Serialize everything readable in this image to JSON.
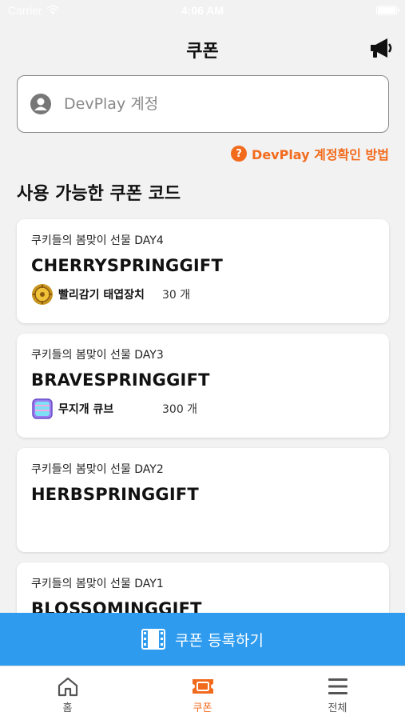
{
  "status_bar": {
    "carrier": "Carrier",
    "time": "4:06 AM"
  },
  "header": {
    "title": "쿠폰",
    "notice_icon": "megaphone-icon"
  },
  "account": {
    "placeholder": "DevPlay 계정",
    "value": ""
  },
  "help_link": {
    "label": "DevPlay 계정확인 방법",
    "icon": "question-icon"
  },
  "section_title": "사용 가능한 쿠폰 코드",
  "coupons": [
    {
      "event": "쿠키들의 봄맞이 선물 DAY4",
      "code": "CHERRYSPRINGGIFT",
      "reward_name": "빨리감기 태엽장치",
      "reward_qty": "30 개",
      "reward_icon": "clockwork-icon"
    },
    {
      "event": "쿠키들의 봄맞이 선물 DAY3",
      "code": "BRAVESPRINGGIFT",
      "reward_name": "무지개 큐브",
      "reward_qty": "300 개",
      "reward_icon": "rainbow-cube-icon"
    },
    {
      "event": "쿠키들의 봄맞이 선물 DAY2",
      "code": "HERBSPRINGGIFT",
      "reward_name": "",
      "reward_qty": ""
    },
    {
      "event": "쿠키들의 봄맞이 선물 DAY1",
      "code": "BLOSSOMINGGIFT",
      "reward_name": "",
      "reward_qty": ""
    }
  ],
  "register_button": {
    "label": "쿠폰 등록하기",
    "icon": "film-icon"
  },
  "tabs": [
    {
      "label": "홈",
      "icon": "home-icon"
    },
    {
      "label": "쿠폰",
      "icon": "coupon-icon",
      "active": true
    },
    {
      "label": "전체",
      "icon": "menu-icon"
    }
  ],
  "colors": {
    "accent": "#f26b1d",
    "button": "#2e9bef",
    "background": "#f2f2f2"
  }
}
